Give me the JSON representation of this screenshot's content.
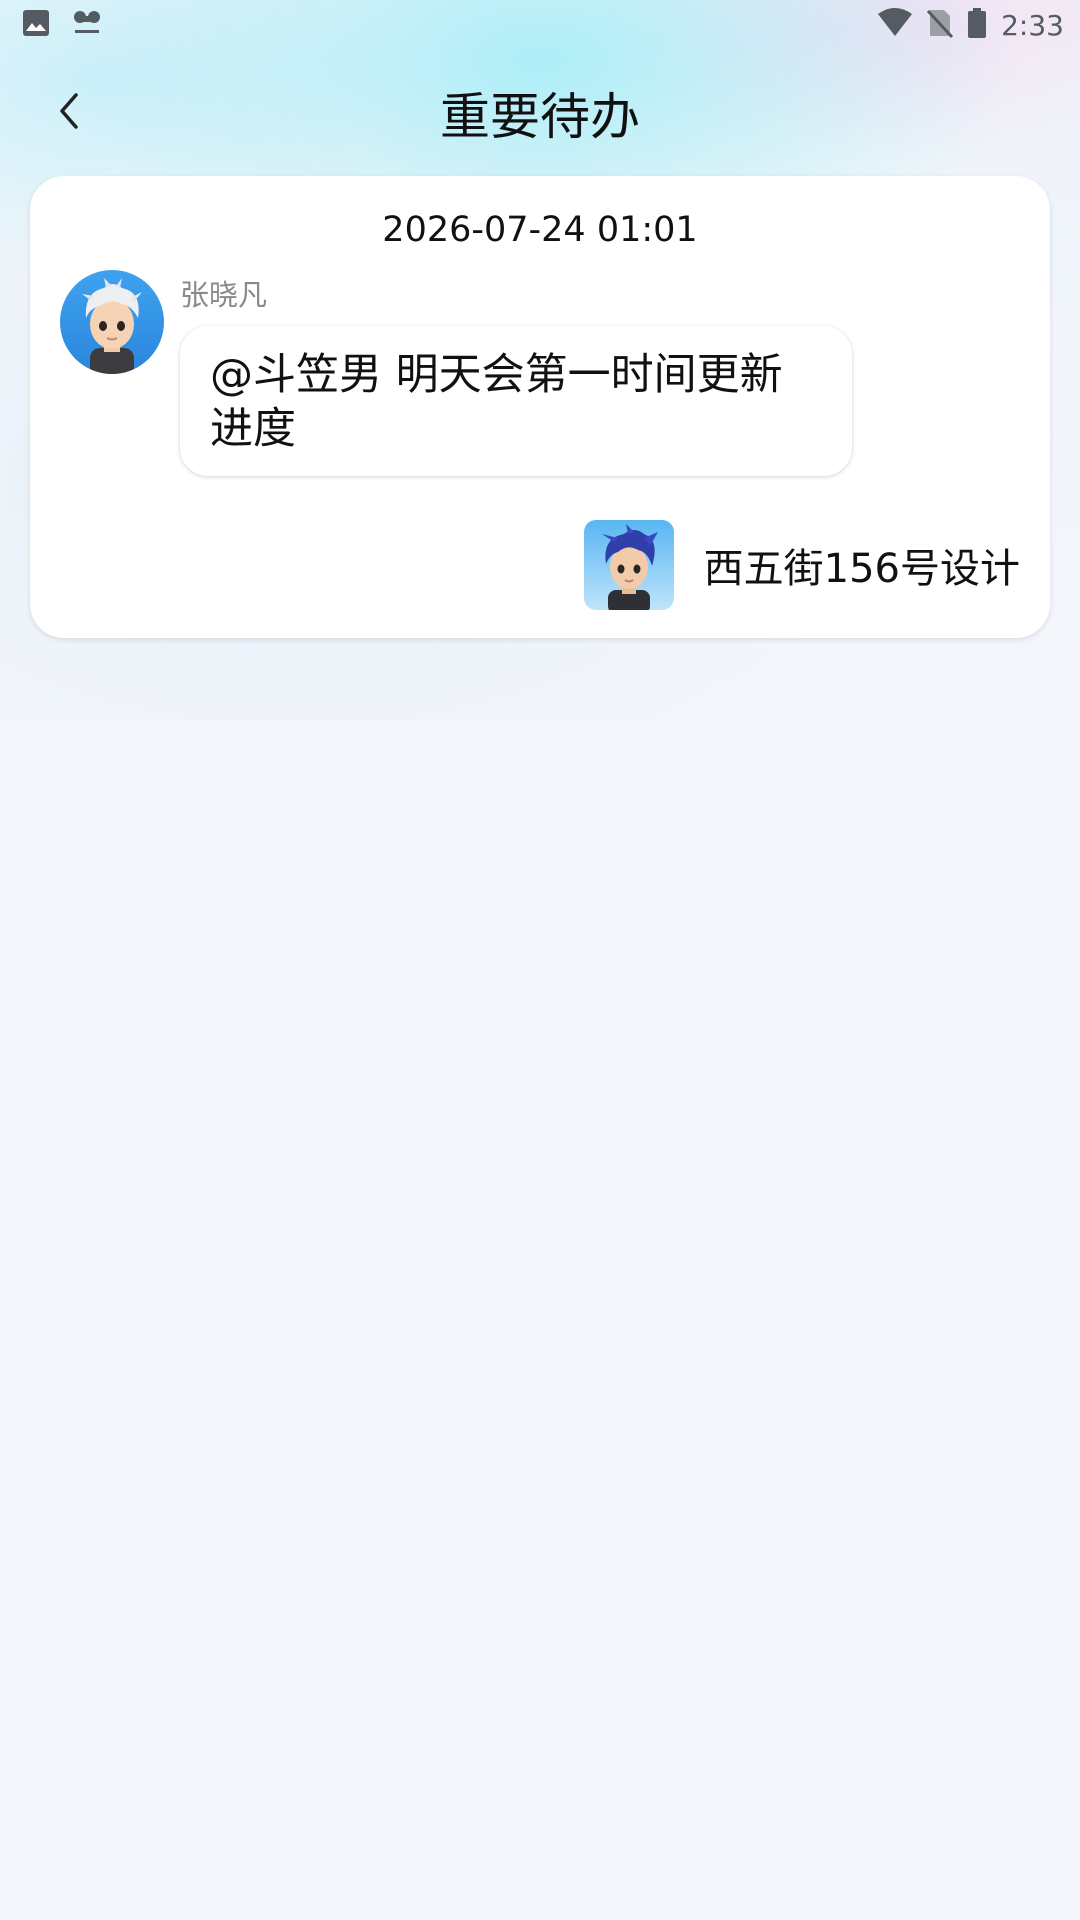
{
  "status_bar": {
    "left_icons": [
      "image-notification-icon",
      "app-notification-icon"
    ],
    "right_icons": [
      "wifi-icon",
      "no-sim-icon",
      "battery-icon"
    ],
    "time": "2:33"
  },
  "header": {
    "title": "重要待办",
    "back_icon": "chevron-left-icon"
  },
  "todo_card": {
    "timestamp": "2026-07-24 01:01",
    "sender": {
      "name": "张晓凡",
      "avatar": "avatar-white-hair-boy"
    },
    "message": "@斗笠男 明天会第一时间更新进度",
    "assignee": {
      "name": "西五街156号设计",
      "avatar": "avatar-blue-hair-boy"
    }
  }
}
